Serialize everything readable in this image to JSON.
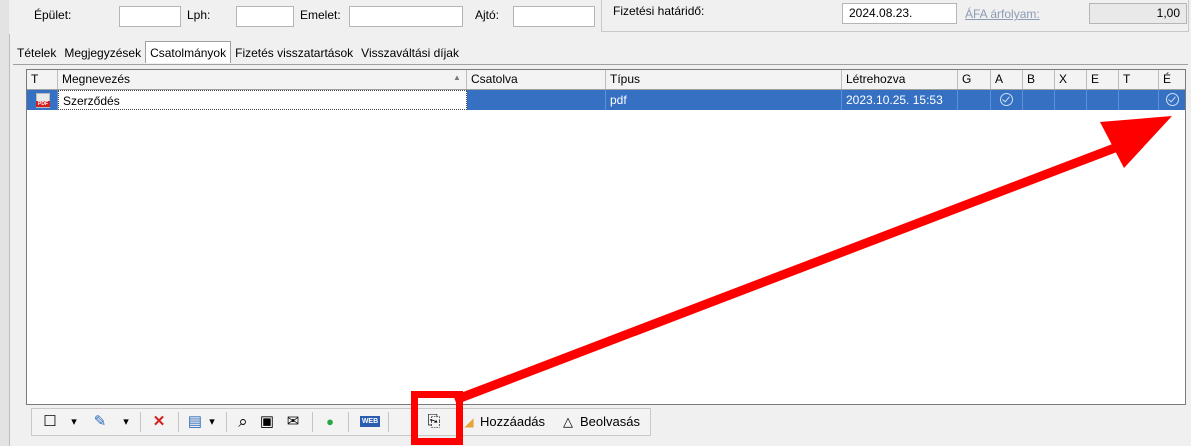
{
  "header": {
    "epulet_label": "Épület:",
    "lph_label": "Lph:",
    "emelet_label": "Emelet:",
    "ajto_label": "Ajtó:",
    "fizetesi_hatarido_label": "Fizetési határidő:",
    "fizetesi_hatarido_value": "2024.08.23.",
    "afa_link": "ÁFA árfolyam:",
    "afa_value": "1,00"
  },
  "tabs": [
    {
      "label": "Tételek"
    },
    {
      "label": "Megjegyzések"
    },
    {
      "label": "Csatolmányok",
      "active": true
    },
    {
      "label": "Fizetés visszatartások"
    },
    {
      "label": "Visszaváltási díjak"
    }
  ],
  "grid": {
    "columns": [
      "T",
      "Megnevezés",
      "Csatolva",
      "Típus",
      "Létrehozva",
      "G",
      "A",
      "B",
      "X",
      "E",
      "T",
      "É"
    ],
    "sort_indicator": "▲",
    "rows": [
      {
        "icon": "pdf-file-icon",
        "icon_text": "PDF",
        "megnevezes": "Szerződés",
        "csatolva": "",
        "tipus": "pdf",
        "letrehozva": "2023.10.25. 15:53",
        "a_checked": true,
        "e_checked": true
      }
    ]
  },
  "toolbar": {
    "new_icon": "☐",
    "edit_icon": "✎",
    "delete_icon": "✕",
    "filter_icon": "▤",
    "search_icon": "⌕",
    "save_icon": "▣",
    "mail_icon": "✉",
    "ok_icon": "●",
    "web_icon": "WEB",
    "attach_icon": "⎘",
    "add_label": "Hozzáadás",
    "scan_label": "Beolvasás",
    "dropdown": "▾"
  },
  "colors": {
    "selection": "#3570c2",
    "annotation": "#ff0000"
  }
}
